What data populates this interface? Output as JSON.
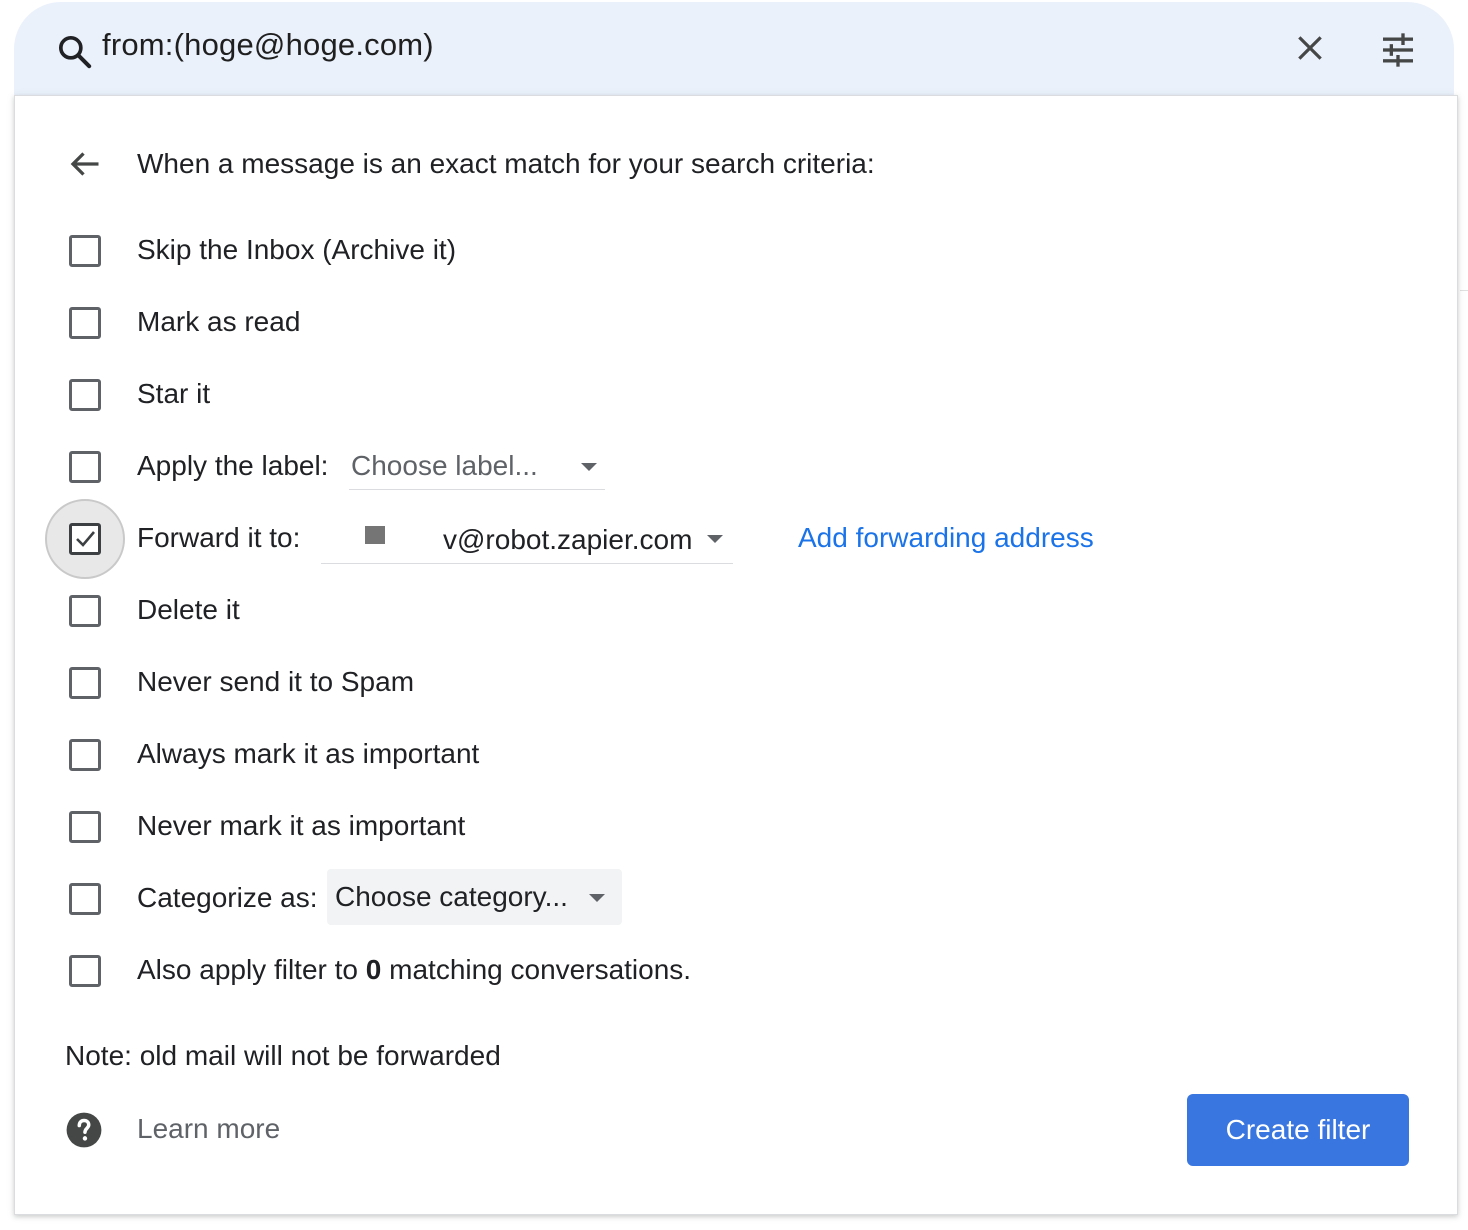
{
  "search": {
    "query": "from:(hoge@hoge.com)"
  },
  "filter": {
    "header": "When a message is an exact match for your search criteria:",
    "options": [
      {
        "label": "Skip the Inbox (Archive it)",
        "checked": false
      },
      {
        "label": "Mark as read",
        "checked": false
      },
      {
        "label": "Star it",
        "checked": false
      },
      {
        "label": "Apply the label:",
        "checked": false
      },
      {
        "label": "Forward it to:",
        "checked": true
      },
      {
        "label": "Delete it",
        "checked": false
      },
      {
        "label": "Never send it to Spam",
        "checked": false
      },
      {
        "label": "Always mark it as important",
        "checked": false
      },
      {
        "label": "Never mark it as important",
        "checked": false
      },
      {
        "label": "Categorize as:",
        "checked": false
      },
      {
        "label": "Also apply filter to 0 matching conversations.",
        "checked": false
      }
    ],
    "label_select": {
      "value": "Choose label..."
    },
    "forward_select": {
      "value": "v@robot.zapier.com"
    },
    "forward_link": "Add forwarding address",
    "category_select": {
      "value": "Choose category..."
    },
    "also_apply": {
      "prefix": "Also apply filter to ",
      "count": "0",
      "suffix": " matching conversations."
    },
    "note": "Note: old mail will not be forwarded",
    "learn_more": "Learn more",
    "create_button": "Create filter"
  },
  "colors": {
    "accent": "#1a73e8",
    "button": "#3a76e0",
    "search_bg": "#eaf1fb"
  },
  "icons": [
    "search-icon",
    "close-icon",
    "tune-icon",
    "arrow-back-icon",
    "help-icon",
    "dropdown-caret-icon"
  ]
}
